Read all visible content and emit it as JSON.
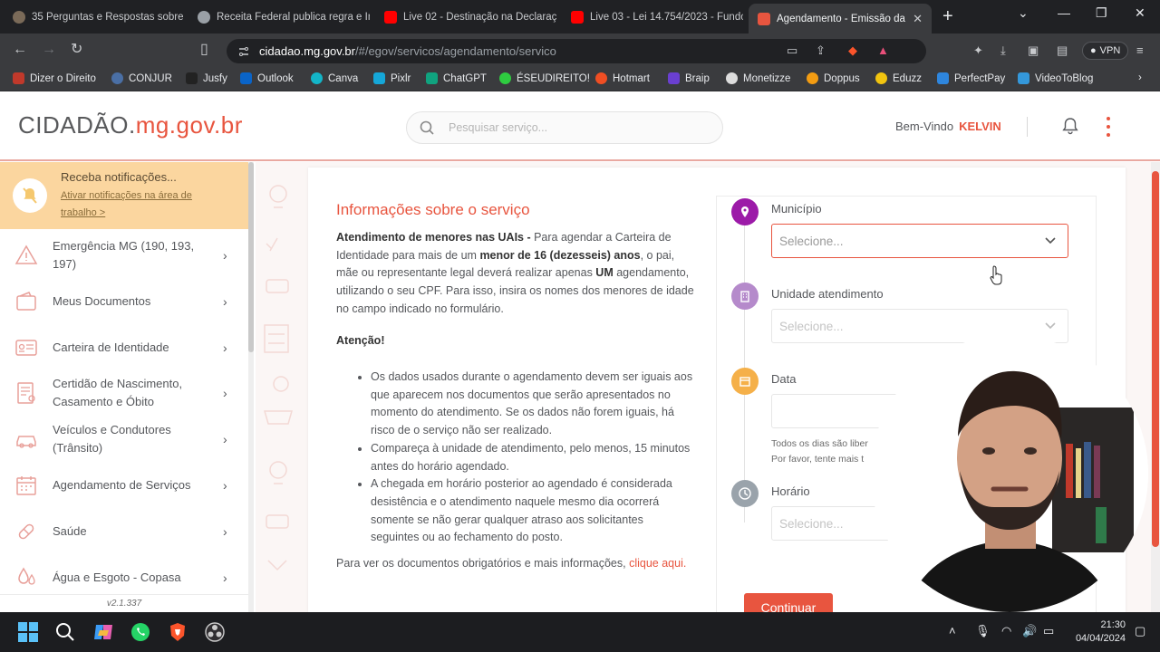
{
  "browser": {
    "tabs": [
      {
        "label": "35 Perguntas e Respostas sobre a",
        "favicon_color": "#7a6a58"
      },
      {
        "label": "Receita Federal publica regra e In",
        "favicon_color": "#9aa0a6"
      },
      {
        "label": "Live 02 - Destinação na Declaraç",
        "favicon_color": "#ff0000"
      },
      {
        "label": "Live 03 - Lei 14.754/2023 - Fundo",
        "favicon_color": "#ff0000"
      },
      {
        "label": "Agendamento - Emissão da",
        "favicon_color": "#e8553f",
        "active": true
      }
    ],
    "new_tab": "+",
    "url_host": "cidadao.mg.gov.br",
    "url_path": "/#/egov/servicos/agendamento/servico",
    "vpn_label": "VPN",
    "bookmarks": [
      {
        "label": "Dizer o Direito",
        "color": "#c0392b"
      },
      {
        "label": "CONJUR",
        "color": "#4a6fa5"
      },
      {
        "label": "Jusfy",
        "color": "#222222"
      },
      {
        "label": "Outlook",
        "color": "#0a64c8"
      },
      {
        "label": "Canva",
        "color": "#13b5c8"
      },
      {
        "label": "Pixlr",
        "color": "#15a7d8"
      },
      {
        "label": "ChatGPT",
        "color": "#10a37f"
      },
      {
        "label": "ÉSEUDIREITO!",
        "color": "#2ecc40"
      },
      {
        "label": "Hotmart",
        "color": "#f04e23"
      },
      {
        "label": "Braip",
        "color": "#6a3fd0"
      },
      {
        "label": "Monetizze",
        "color": "#dddddd"
      },
      {
        "label": "Doppus",
        "color": "#f39c12"
      },
      {
        "label": "Eduzz",
        "color": "#f1c40f"
      },
      {
        "label": "PerfectPay",
        "color": "#2e86de"
      },
      {
        "label": "VideoToBlog",
        "color": "#3498db"
      }
    ]
  },
  "header": {
    "logo_main": "CIDADÃO.",
    "logo_accent": "mg.gov.br",
    "search_placeholder": "Pesquisar serviço...",
    "welcome": "Bem-Vindo",
    "user": "KELVIN"
  },
  "sidebar": {
    "notification_title": "Receba notificações...",
    "notification_link": "Ativar notificações na área de trabalho >",
    "items": [
      {
        "label": "Emergência MG (190, 193, 197)",
        "icon": "warning-icon"
      },
      {
        "label": "Meus Documentos",
        "icon": "wallet-icon"
      },
      {
        "label": "Carteira de Identidade",
        "icon": "id-card-icon"
      },
      {
        "label": "Certidão de Nascimento, Casamento e Óbito",
        "icon": "certificate-icon"
      },
      {
        "label": "Veículos e Condutores (Trânsito)",
        "icon": "car-icon"
      },
      {
        "label": "Agendamento de Serviços",
        "icon": "calendar-icon"
      },
      {
        "label": "Saúde",
        "icon": "pill-icon"
      },
      {
        "label": "Água e Esgoto - Copasa",
        "icon": "water-drop-icon"
      }
    ],
    "version": "v2.1.337"
  },
  "content": {
    "title": "Informações sobre o serviço",
    "para1_bold": "Atendimento de menores nas UAIs -",
    "para1_a": " Para agendar a Carteira de Identidade para mais de um ",
    "para1_bold2": "menor de 16 (dezesseis) anos",
    "para1_b": ", o pai, mãe ou representante legal deverá realizar apenas ",
    "para1_bold3": "UM",
    "para1_c": " agendamento, utilizando o seu CPF. Para isso, insira os nomes dos menores de idade no campo indicado no formulário.",
    "attention": "Atenção!",
    "bullets": [
      "Os dados usados durante o agendamento devem ser iguais aos que aparecem nos documentos que serão apresentados no momento do atendimento. Se os dados não forem iguais, há risco de o serviço não ser realizado.",
      "Compareça à unidade de atendimento, pelo menos, 15 minutos antes do horário agendado.",
      "A chegada em horário posterior ao agendado é considerada desistência e o atendimento naquele mesmo dia ocorrerá somente se não gerar qualquer atraso aos solicitantes seguintes ou ao fechamento do posto."
    ],
    "footer_text": "Para ver os documentos obrigatórios e mais informações, ",
    "footer_link": "clique aqui."
  },
  "form": {
    "municipio_label": "Município",
    "municipio_value": "Selecione...",
    "unidade_label": "Unidade atendimento",
    "unidade_value": "Selecione...",
    "data_label": "Data",
    "data_hint1": "Todos os dias são liber",
    "data_hint2": "Por favor, tente mais t",
    "horario_label": "Horário",
    "horario_value": "Selecione...",
    "submit": "Continuar",
    "colors": {
      "municipio": "#9c1aa8",
      "unidade": "#b58acb",
      "data": "#f5b049",
      "horario": "#9aa3ab"
    }
  },
  "taskbar": {
    "time": "21:30",
    "date": "04/04/2024"
  }
}
